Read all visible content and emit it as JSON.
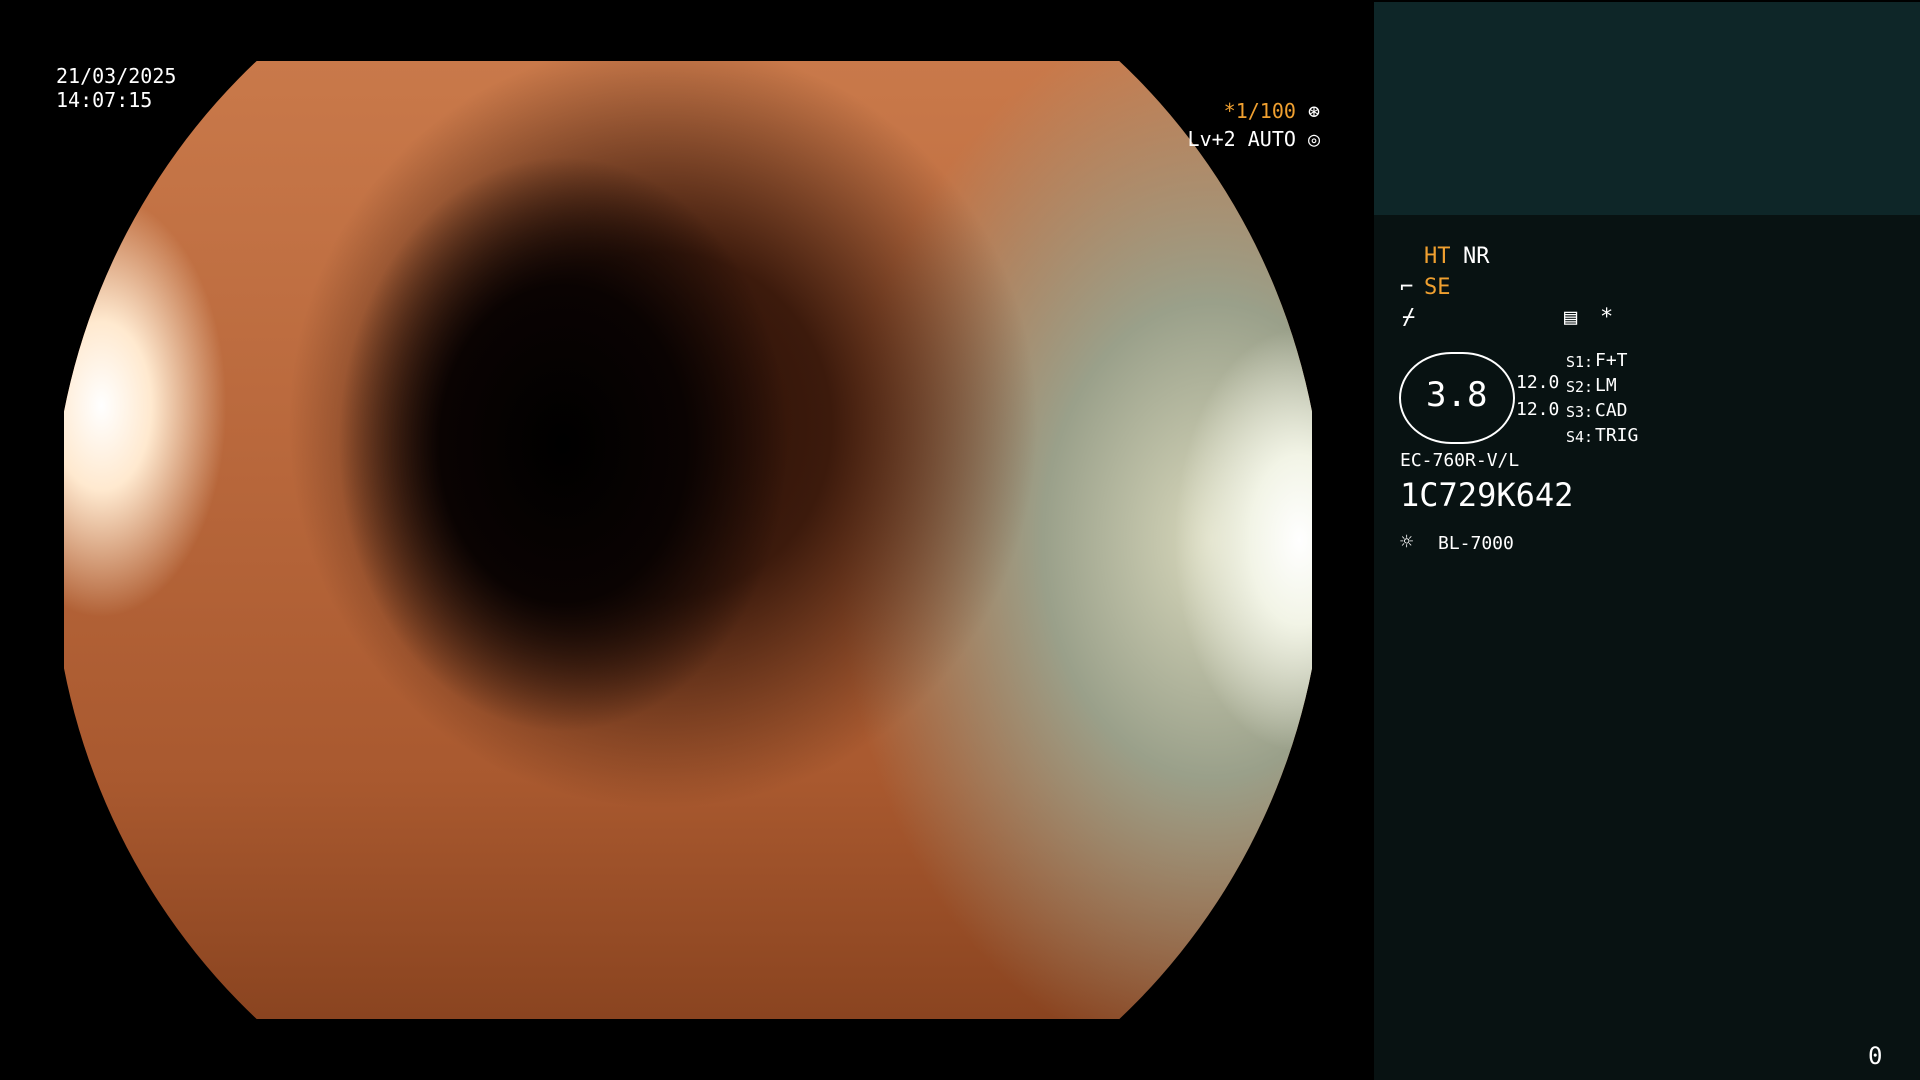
{
  "overlay": {
    "date": "21/03/2025",
    "time": "14:07:15",
    "shutter": "*1/100",
    "level": "Lv+2 AUTO"
  },
  "panel": {
    "mode_ht": "HT",
    "mode_nr": "NR",
    "mode_se": "SE",
    "asterisk": "*",
    "gauge_value": "3.8",
    "value_1": "12.0",
    "value_2": "12.0",
    "switch_labels": [
      "S1:",
      "S2:",
      "S3:",
      "S4:"
    ],
    "switch_values": [
      "F+T",
      "LM",
      "CAD",
      "TRIG"
    ],
    "scope_model": "EC-760R-V/L",
    "scope_serial": "1C729K642",
    "light_source": "BL-7000",
    "page_number": "0"
  },
  "icons": {
    "shutter_icon": "aperture-icon",
    "level_icon": "target-icon",
    "se_icon": "pump-icon",
    "enhance_icon": "slash-icon",
    "memo_icon": "document-icon",
    "light_icon": "sun-icon"
  },
  "colors": {
    "accent": "#f0a030",
    "panel_bg": "#081212",
    "panel_top_bg": "#0e2628"
  }
}
